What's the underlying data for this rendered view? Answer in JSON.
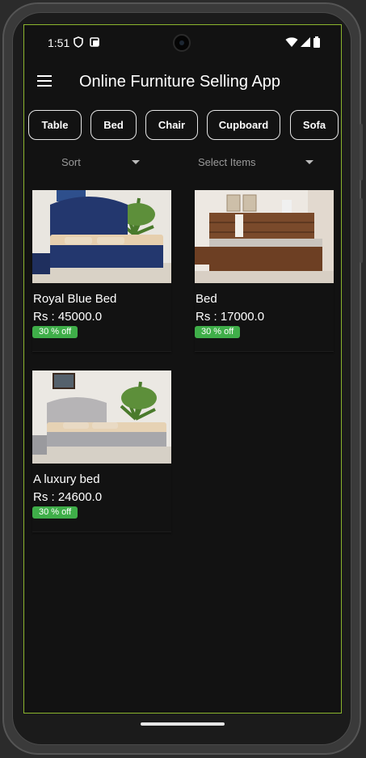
{
  "status_bar": {
    "time": "1:51",
    "icons": [
      "shield-icon",
      "screenshot-icon",
      "wifi-icon",
      "signal-icon",
      "battery-icon"
    ]
  },
  "app_bar": {
    "title": "Online Furniture Selling App",
    "menu_icon": "menu-icon"
  },
  "categories": [
    "Table",
    "Bed",
    "Chair",
    "Cupboard",
    "Sofa"
  ],
  "filters": {
    "sort_label": "Sort",
    "select_label": "Select Items"
  },
  "products": [
    {
      "name": "Royal Blue Bed",
      "price": "Rs : 45000.0",
      "discount": "30 % off",
      "bed_color": "#23376e"
    },
    {
      "name": "Bed",
      "price": "Rs : 17000.0",
      "discount": "30 % off",
      "bed_color": "#7a4a2b"
    },
    {
      "name": "A luxury bed",
      "price": "Rs : 24600.0",
      "discount": "30 % off",
      "bed_color": "#a7a7ab"
    }
  ],
  "colors": {
    "background": "#121212",
    "accent_border": "#8bb42d",
    "badge_green": "#3fae49",
    "chip_border": "#e6e6e6"
  }
}
